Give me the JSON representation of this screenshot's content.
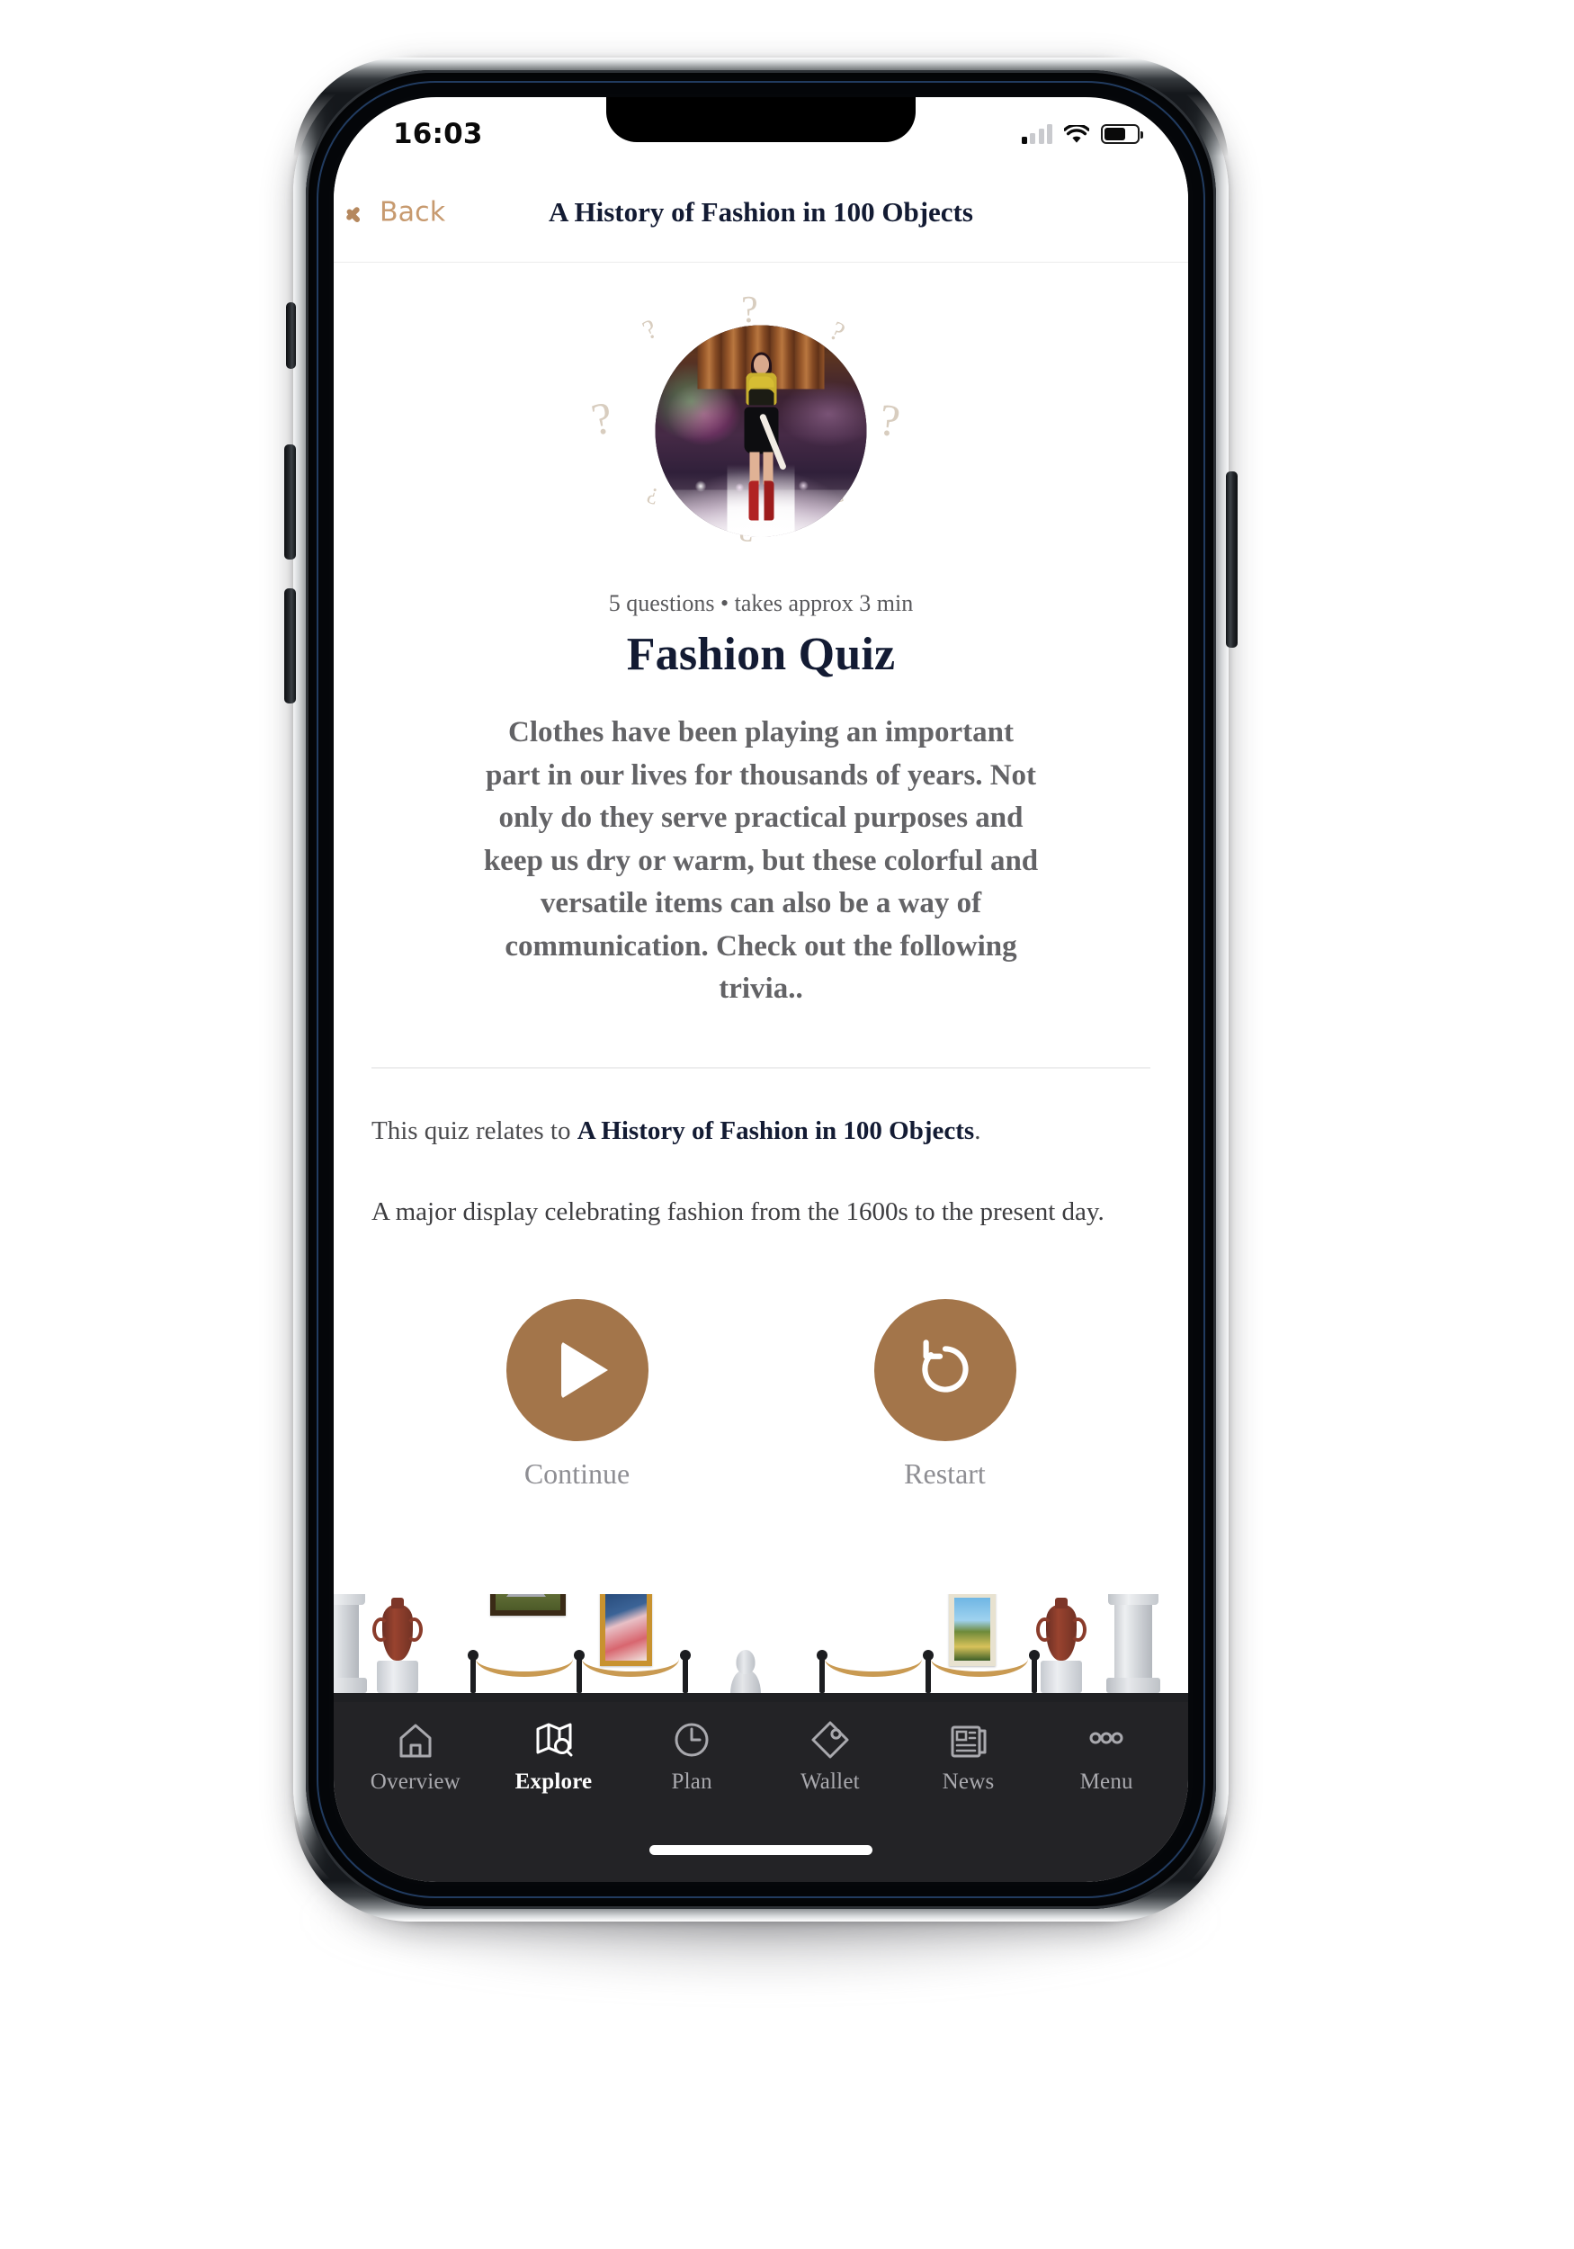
{
  "status_bar": {
    "time": "16:03",
    "signal_icon": "cellular-signal-icon",
    "wifi_icon": "wifi-icon",
    "battery_icon": "battery-icon"
  },
  "header": {
    "back_label": "Back",
    "back_icon": "chevron-left-icon",
    "title": "A History of Fashion in 100 Objects"
  },
  "quiz": {
    "hero_image_alt": "fashion runway model photo",
    "question_mark": "?",
    "meta": "5 questions • takes approx 3 min",
    "title": "Fashion Quiz",
    "description": "Clothes have been playing an important part in our lives for thousands of years. Not only do they serve practical purposes and keep us dry or warm, but these colorful and versatile items can also be a way of communication. Check out the following trivia..",
    "relates_prefix": "This quiz relates to ",
    "relates_exhibit": "A History of Fashion in 100 Objects",
    "relates_suffix": ".",
    "exhibit_description": "A major display celebrating fashion from the 1600s to the present day."
  },
  "actions": {
    "continue": {
      "label": "Continue",
      "icon": "play-icon"
    },
    "restart": {
      "label": "Restart",
      "icon": "restart-counterclockwise-icon"
    },
    "button_color": "#a3754a"
  },
  "museum_strip": {
    "alt": "museum gallery illustration with columns, vases, paintings, statue and rope barriers"
  },
  "tabbar": {
    "background_color": "#232326",
    "active_index": 1,
    "items": [
      {
        "label": "Overview",
        "icon": "home-icon"
      },
      {
        "label": "Explore",
        "icon": "map-search-icon"
      },
      {
        "label": "Plan",
        "icon": "clock-icon"
      },
      {
        "label": "Wallet",
        "icon": "ticket-tag-icon"
      },
      {
        "label": "News",
        "icon": "newspaper-icon"
      },
      {
        "label": "Menu",
        "icon": "three-dots-icon"
      }
    ]
  },
  "theme": {
    "accent": "#a3754a",
    "back_link": "#c79a6f",
    "title_navy": "#131b33",
    "body_gray": "#636366"
  }
}
